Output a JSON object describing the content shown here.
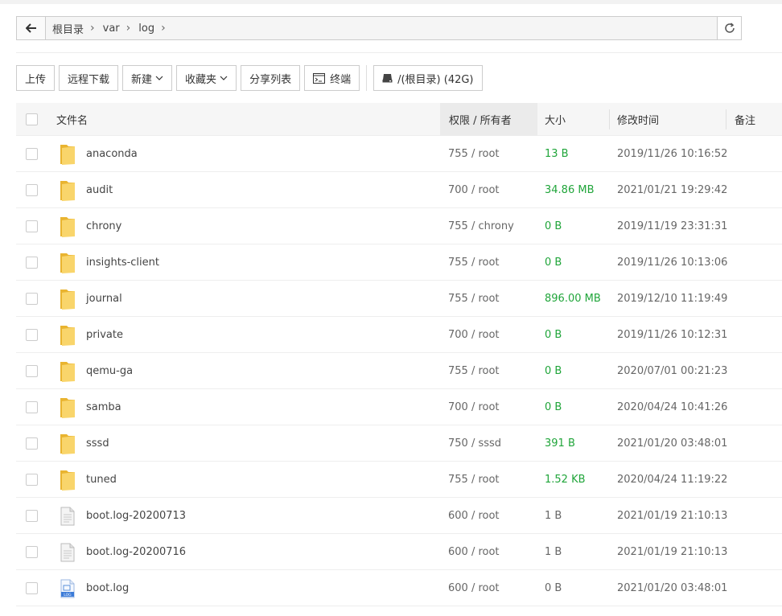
{
  "path": {
    "crumbs": [
      "根目录",
      "var",
      "log"
    ]
  },
  "toolbar": {
    "upload": "上传",
    "remote_download": "远程下载",
    "new": "新建",
    "favorites": "收藏夹",
    "share_list": "分享列表",
    "terminal": "终端",
    "disk": "/(根目录) (42G)"
  },
  "table": {
    "headers": {
      "name": "文件名",
      "perm": "权限 / 所有者",
      "size": "大小",
      "mtime": "修改时间",
      "note": "备注"
    },
    "rows": [
      {
        "type": "folder",
        "name": "anaconda",
        "perm": "755 / root",
        "size": "13 B",
        "mtime": "2019/11/26 10:16:52"
      },
      {
        "type": "folder",
        "name": "audit",
        "perm": "700 / root",
        "size": "34.86 MB",
        "mtime": "2021/01/21 19:29:42"
      },
      {
        "type": "folder",
        "name": "chrony",
        "perm": "755 / chrony",
        "size": "0 B",
        "mtime": "2019/11/19 23:31:31"
      },
      {
        "type": "folder",
        "name": "insights-client",
        "perm": "755 / root",
        "size": "0 B",
        "mtime": "2019/11/26 10:13:06"
      },
      {
        "type": "folder",
        "name": "journal",
        "perm": "755 / root",
        "size": "896.00 MB",
        "mtime": "2019/12/10 11:19:49"
      },
      {
        "type": "folder",
        "name": "private",
        "perm": "700 / root",
        "size": "0 B",
        "mtime": "2019/11/26 10:12:31"
      },
      {
        "type": "folder",
        "name": "qemu-ga",
        "perm": "755 / root",
        "size": "0 B",
        "mtime": "2020/07/01 00:21:23"
      },
      {
        "type": "folder",
        "name": "samba",
        "perm": "700 / root",
        "size": "0 B",
        "mtime": "2020/04/24 10:41:26"
      },
      {
        "type": "folder",
        "name": "sssd",
        "perm": "750 / sssd",
        "size": "391 B",
        "mtime": "2021/01/20 03:48:01"
      },
      {
        "type": "folder",
        "name": "tuned",
        "perm": "755 / root",
        "size": "1.52 KB",
        "mtime": "2020/04/24 11:19:22"
      },
      {
        "type": "file",
        "name": "boot.log-20200713",
        "perm": "600 / root",
        "size": "1 B",
        "mtime": "2021/01/19 21:10:13"
      },
      {
        "type": "file",
        "name": "boot.log-20200716",
        "perm": "600 / root",
        "size": "1 B",
        "mtime": "2021/01/19 21:10:13"
      },
      {
        "type": "log",
        "name": "boot.log",
        "perm": "600 / root",
        "size": "0 B",
        "mtime": "2021/01/20 03:48:01"
      }
    ]
  },
  "icons": {
    "back": "arrow-left-icon",
    "refresh": "refresh-icon",
    "terminal": "terminal-icon",
    "disk": "disk-icon",
    "folder": "folder-icon",
    "file": "file-icon",
    "log": "log-file-icon"
  },
  "colors": {
    "size_text": "#20a53a",
    "folder": "#f5c542"
  }
}
